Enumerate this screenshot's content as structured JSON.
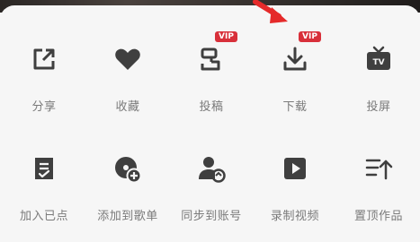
{
  "vip_badge": "VIP",
  "colors": {
    "icon": "#3f3f3f",
    "label": "#7a7a7a",
    "vip": "#d8303a",
    "background": "#f6f6f6"
  },
  "row1": [
    {
      "label": "分享",
      "icon": "share-icon"
    },
    {
      "label": "收藏",
      "icon": "heart-icon"
    },
    {
      "label": "投稿",
      "icon": "submit-icon"
    },
    {
      "label": "下载",
      "icon": "download-icon"
    },
    {
      "label": "投屏",
      "icon": "tv-icon"
    }
  ],
  "row2": [
    {
      "label": "加入已点",
      "icon": "checklist-icon"
    },
    {
      "label": "添加到歌单",
      "icon": "disc-add-icon"
    },
    {
      "label": "同步到账号",
      "icon": "user-sync-icon"
    },
    {
      "label": "录制视频",
      "icon": "play-icon"
    },
    {
      "label": "置顶作品",
      "icon": "pin-top-icon"
    }
  ]
}
